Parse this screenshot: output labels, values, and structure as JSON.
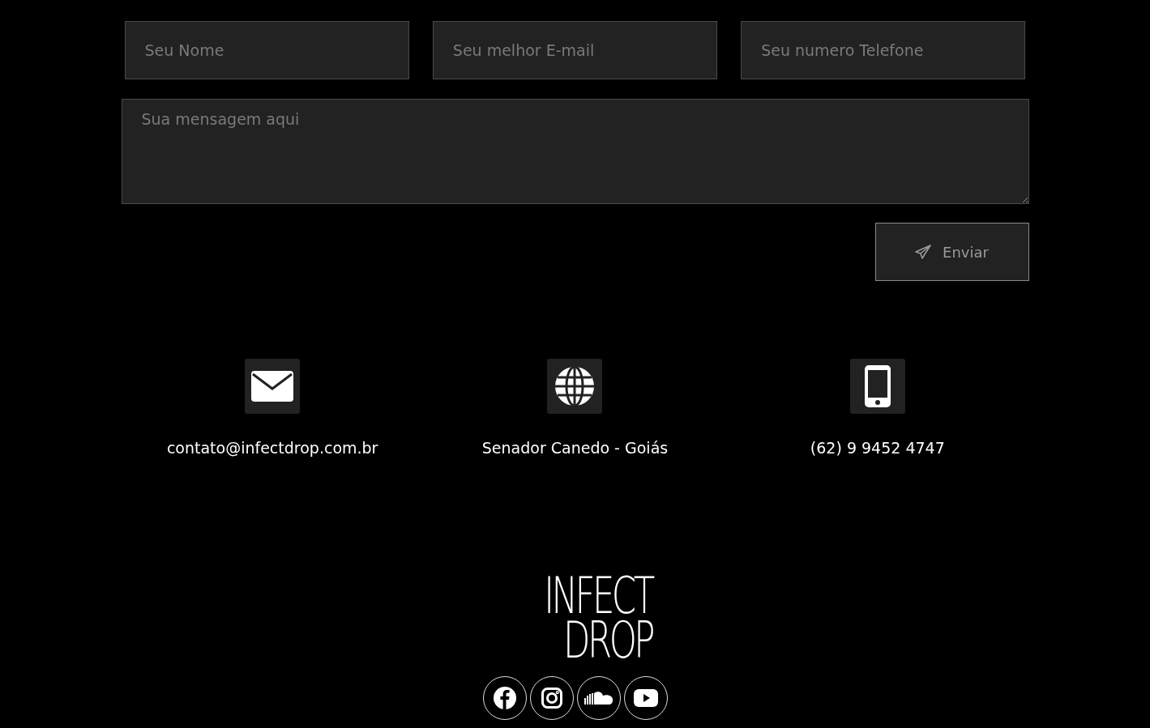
{
  "form": {
    "fields": [
      {
        "placeholder": "Seu Nome"
      },
      {
        "placeholder": "Seu melhor E-mail"
      },
      {
        "placeholder": "Seu numero Telefone"
      }
    ],
    "message": {
      "placeholder": "Sua mensagem aqui"
    },
    "submit": {
      "label": "Enviar"
    }
  },
  "contacts": [
    {
      "kind": "email",
      "text": "contato@infectdrop.com.br"
    },
    {
      "kind": "location",
      "text": "Senador Canedo - Goiás"
    },
    {
      "kind": "phone",
      "text": "(62) 9 9452 4747"
    }
  ],
  "logo": {
    "lines": [
      "INFECT",
      "DROP"
    ]
  },
  "socials": [
    {
      "kind": "facebook"
    },
    {
      "kind": "instagram"
    },
    {
      "kind": "soundcloud"
    },
    {
      "kind": "youtube"
    }
  ]
}
